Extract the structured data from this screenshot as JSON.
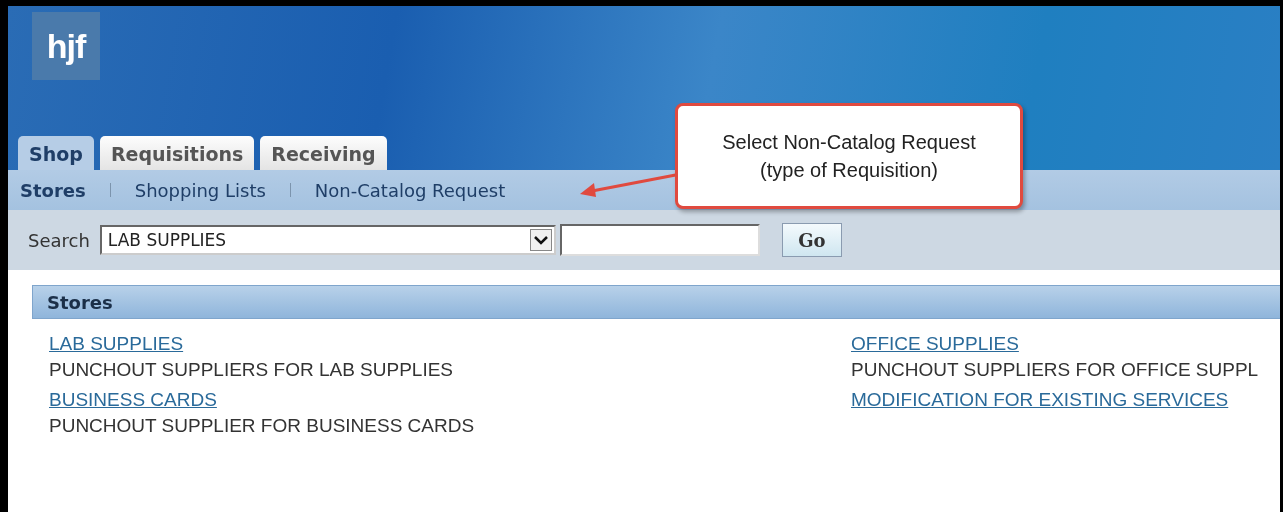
{
  "logo": {
    "text": "hjf"
  },
  "tabs": [
    {
      "label": "Shop",
      "selected": true
    },
    {
      "label": "Requisitions",
      "selected": false
    },
    {
      "label": "Receiving",
      "selected": false
    }
  ],
  "subnav": [
    {
      "label": "Stores",
      "selected": true
    },
    {
      "label": "Shopping Lists",
      "selected": false
    },
    {
      "label": "Non-Catalog Request",
      "selected": false
    }
  ],
  "search": {
    "label": "Search",
    "value": "LAB SUPPLIES",
    "button": "Go"
  },
  "callout": {
    "lines": [
      "Select Non-Catalog Request",
      "(type of Requisition)"
    ]
  },
  "stores": {
    "title": "Stores",
    "columns": [
      [
        {
          "link": "LAB SUPPLIES",
          "description": "PUNCHOUT SUPPLIERS FOR LAB SUPPLIES"
        },
        {
          "link": "BUSINESS CARDS",
          "description": "PUNCHOUT SUPPLIER FOR BUSINESS CARDS"
        }
      ],
      [
        {
          "link": "OFFICE SUPPLIES",
          "description": "PUNCHOUT SUPPLIERS FOR OFFICE SUPPL"
        },
        {
          "link": "MODIFICATION FOR EXISTING SERVICES"
        }
      ]
    ]
  }
}
